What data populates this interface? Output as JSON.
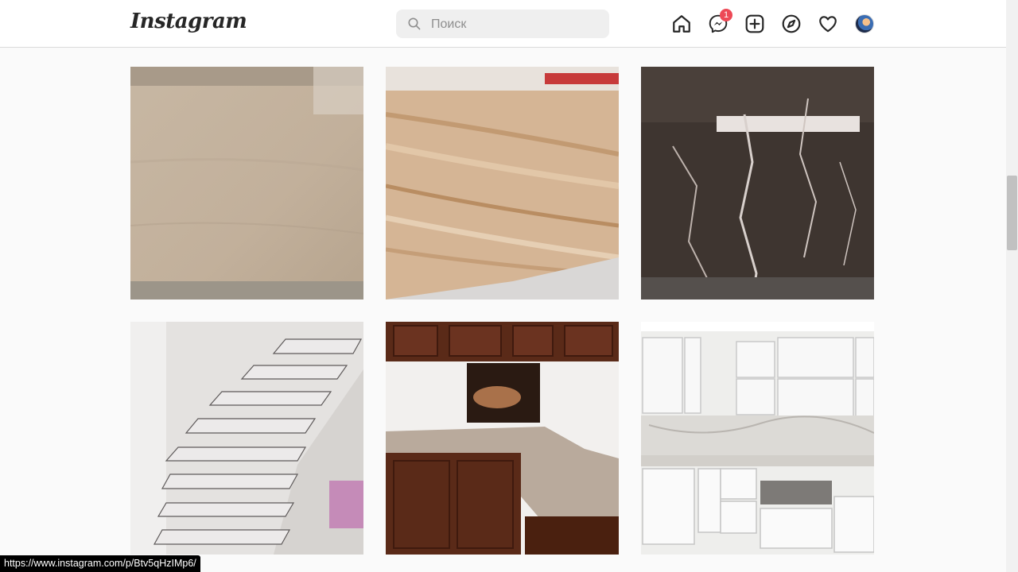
{
  "header": {
    "logo": "Instagram",
    "search_placeholder": "Поиск",
    "messenger_badge": "1"
  },
  "icons": [
    "home-icon",
    "messenger-icon",
    "new-post-icon",
    "explore-icon",
    "activity-heart-icon",
    "profile-avatar"
  ],
  "posts": [
    {
      "subject": "beige marble slab"
    },
    {
      "subject": "travertine slab"
    },
    {
      "subject": "dark marble slab"
    },
    {
      "subject": "marble staircase"
    },
    {
      "subject": "kitchen with stone countertop"
    },
    {
      "subject": "white kitchen with marble backsplash"
    }
  ],
  "status_bar": {
    "url": "https://www.instagram.com/p/Btv5qHzIMp6/"
  },
  "colors": {
    "badge": "#ed4956",
    "search_bg": "#efefef",
    "page_bg": "#fafafa"
  }
}
